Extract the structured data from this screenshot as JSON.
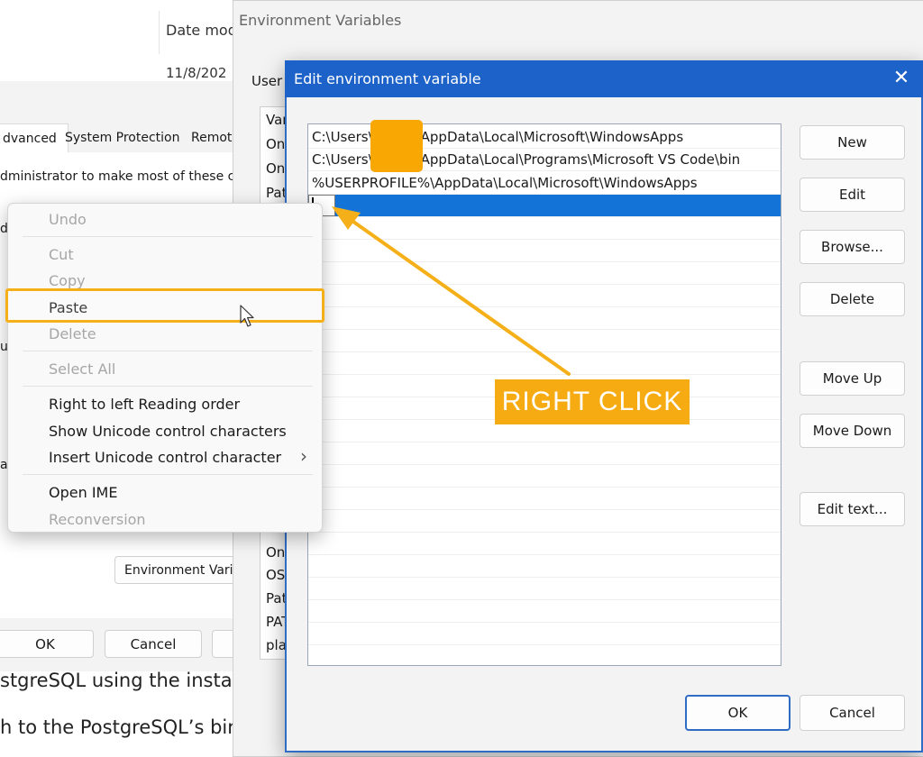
{
  "explorer": {
    "date_header": "Date mod",
    "date_value": "11/8/202"
  },
  "system_properties": {
    "tabs": [
      "dvanced",
      "System Protection",
      "Remot"
    ],
    "admin_text": "dministrator to make most of these char",
    "env_button": "Environment Varia",
    "ok": "OK",
    "cancel": "Cancel",
    "side_chars": [
      "d",
      "ur",
      "a"
    ]
  },
  "document": {
    "line1": "stgreSQL using the instal",
    "line2": "h to the PostgreSQL’s bir"
  },
  "env_window": {
    "title": "Environment Variables",
    "user_label": "User",
    "user_items": [
      "Var",
      "On",
      "On",
      "Pat"
    ],
    "system_items": [
      "On",
      "OS",
      "Pat",
      "PAT",
      "pla"
    ]
  },
  "edit_dialog": {
    "title": "Edit environment variable",
    "paths": [
      "C:\\Users\\",
      "C:\\Users\\",
      "%USERPROFILE%\\AppData\\Local\\Microsoft\\WindowsApps",
      ""
    ],
    "path_suffixes": [
      "AppData\\Local\\Microsoft\\WindowsApps",
      "AppData\\Local\\Programs\\Microsoft VS Code\\bin"
    ],
    "buttons": {
      "new": "New",
      "edit": "Edit",
      "browse": "Browse...",
      "delete": "Delete",
      "move_up": "Move Up",
      "move_down": "Move Down",
      "edit_text": "Edit text...",
      "ok": "OK",
      "cancel": "Cancel"
    }
  },
  "context_menu": {
    "undo": "Undo",
    "cut": "Cut",
    "copy": "Copy",
    "paste": "Paste",
    "delete": "Delete",
    "select_all": "Select All",
    "rtl": "Right to left Reading order",
    "show_unicode": "Show Unicode control characters",
    "insert_unicode": "Insert Unicode control character",
    "submenu_arrow": "›",
    "open_ime": "Open IME",
    "reconversion": "Reconversion"
  },
  "annotation": {
    "label": "RIGHT CLICK",
    "color": "#f7ab12"
  },
  "colors": {
    "title_bar": "#1d62c9",
    "selection": "#1473d6",
    "redaction": "#f9a803"
  }
}
